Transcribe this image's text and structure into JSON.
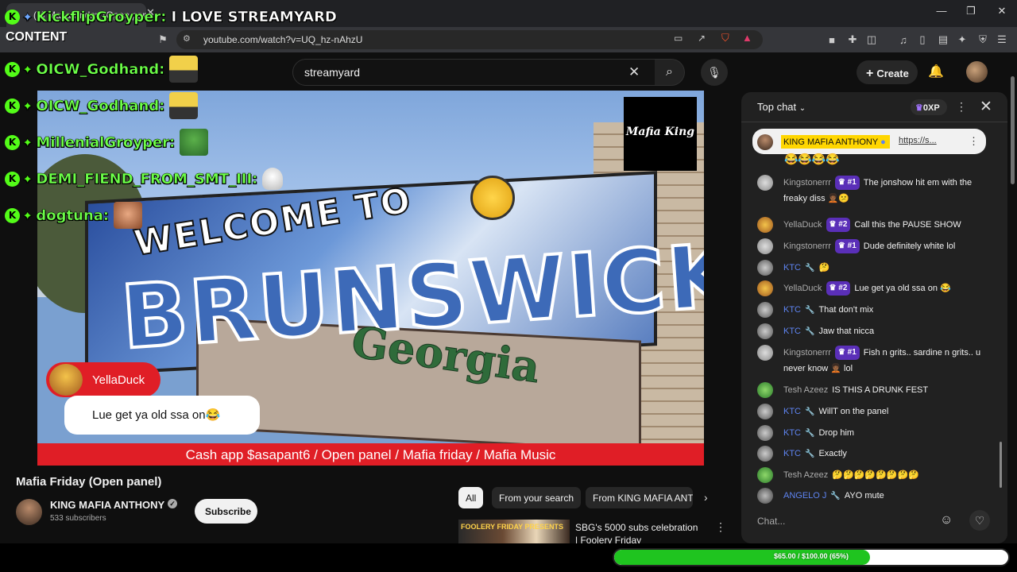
{
  "browser": {
    "tab_title": "(2) Mafia Friday (Open panel)",
    "address": "youtube.com/watch?v=UQ_hz-nAhzU",
    "window_controls": {
      "minimize": "—",
      "maximize": "❐",
      "close": "✕"
    }
  },
  "overlay": {
    "content_label": "CONTENT",
    "messages": [
      {
        "user": "KickflipGroyper:",
        "text": "I LOVE STREAMYARD"
      },
      {
        "user": "OICW_Godhand:",
        "text": ""
      },
      {
        "user": "OICW_Godhand:",
        "text": ""
      },
      {
        "user": "MillenialGroyper:",
        "text": ""
      },
      {
        "user": "DEMI_FIEND_FROM_SMT_III:",
        "text": ""
      },
      {
        "user": "dogtuna:",
        "text": ""
      }
    ],
    "badge_letter": "K",
    "colors": {
      "name_green": "#6cff48",
      "badge_green": "#53fc18"
    }
  },
  "youtube": {
    "search_value": "streamyard",
    "create_label": "Create",
    "video": {
      "sign_welcome": "WELCOME TO",
      "sign_city": "BRUNSWICK",
      "sign_state": "Georgia",
      "logo_text": "Mafia King",
      "banner": "Cash app $asapant6 / Open panel / Mafia friday / Mafia Music",
      "comment_user": "YellaDuck",
      "comment_text": "Lue get ya old ssa on😂"
    },
    "title": "Mafia Friday (Open panel)",
    "channel": "KING MAFIA ANTHONY",
    "subscribers": "533 subscribers",
    "subscribe_label": "Subscribe",
    "chips": [
      "All",
      "From your search",
      "From KING MAFIA ANT"
    ],
    "recommendation": {
      "thumb_text": "FOOLERY FRIDAY PRESENTS",
      "title": "SBG's 5000 subs celebration | Foolery Friday"
    }
  },
  "chat": {
    "mode": "Top chat",
    "xp": "0XP",
    "pinned": {
      "author": "KING MAFIA ANTHONY",
      "link": "https://s..."
    },
    "pinned_emojis": "😂😂😂😂",
    "messages": [
      {
        "author": "Kingstonerrr",
        "rank": "#1",
        "text": "The jonshow hit em with the freaky diss 🧑🏾‍🦱😕"
      },
      {
        "author": "YellaDuck",
        "rank": "#2",
        "text": "Call this the PAUSE SHOW"
      },
      {
        "author": "Kingstonerrr",
        "rank": "#1",
        "text": "Dude definitely white lol"
      },
      {
        "author": "KTC",
        "mod": true,
        "text": "🤔"
      },
      {
        "author": "YellaDuck",
        "rank": "#2",
        "text": "Lue get ya old ssa on 😂"
      },
      {
        "author": "KTC",
        "mod": true,
        "text": "That don't mix"
      },
      {
        "author": "KTC",
        "mod": true,
        "text": "Jaw that nicca"
      },
      {
        "author": "Kingstonerrr",
        "rank": "#1",
        "text": "Fish n grits.. sardine n grits.. u never know 🧑🏾‍🦱 lol"
      },
      {
        "author": "Tesh Azeez",
        "text": "IS THIS A DRUNK FEST"
      },
      {
        "author": "KTC",
        "mod": true,
        "text": "WillT on the panel"
      },
      {
        "author": "KTC",
        "mod": true,
        "text": "Drop him"
      },
      {
        "author": "KTC",
        "mod": true,
        "text": "Exactly"
      },
      {
        "author": "Tesh Azeez",
        "text": "🤔🤔🤔🤔🤔🤔🤔🤔"
      },
      {
        "author": "ANGELO J",
        "mod": true,
        "text": "AYO mute"
      }
    ],
    "input_placeholder": "Chat..."
  },
  "donation": {
    "label": "$65.00 / $100.00 (65%)",
    "progress": 0.65
  }
}
